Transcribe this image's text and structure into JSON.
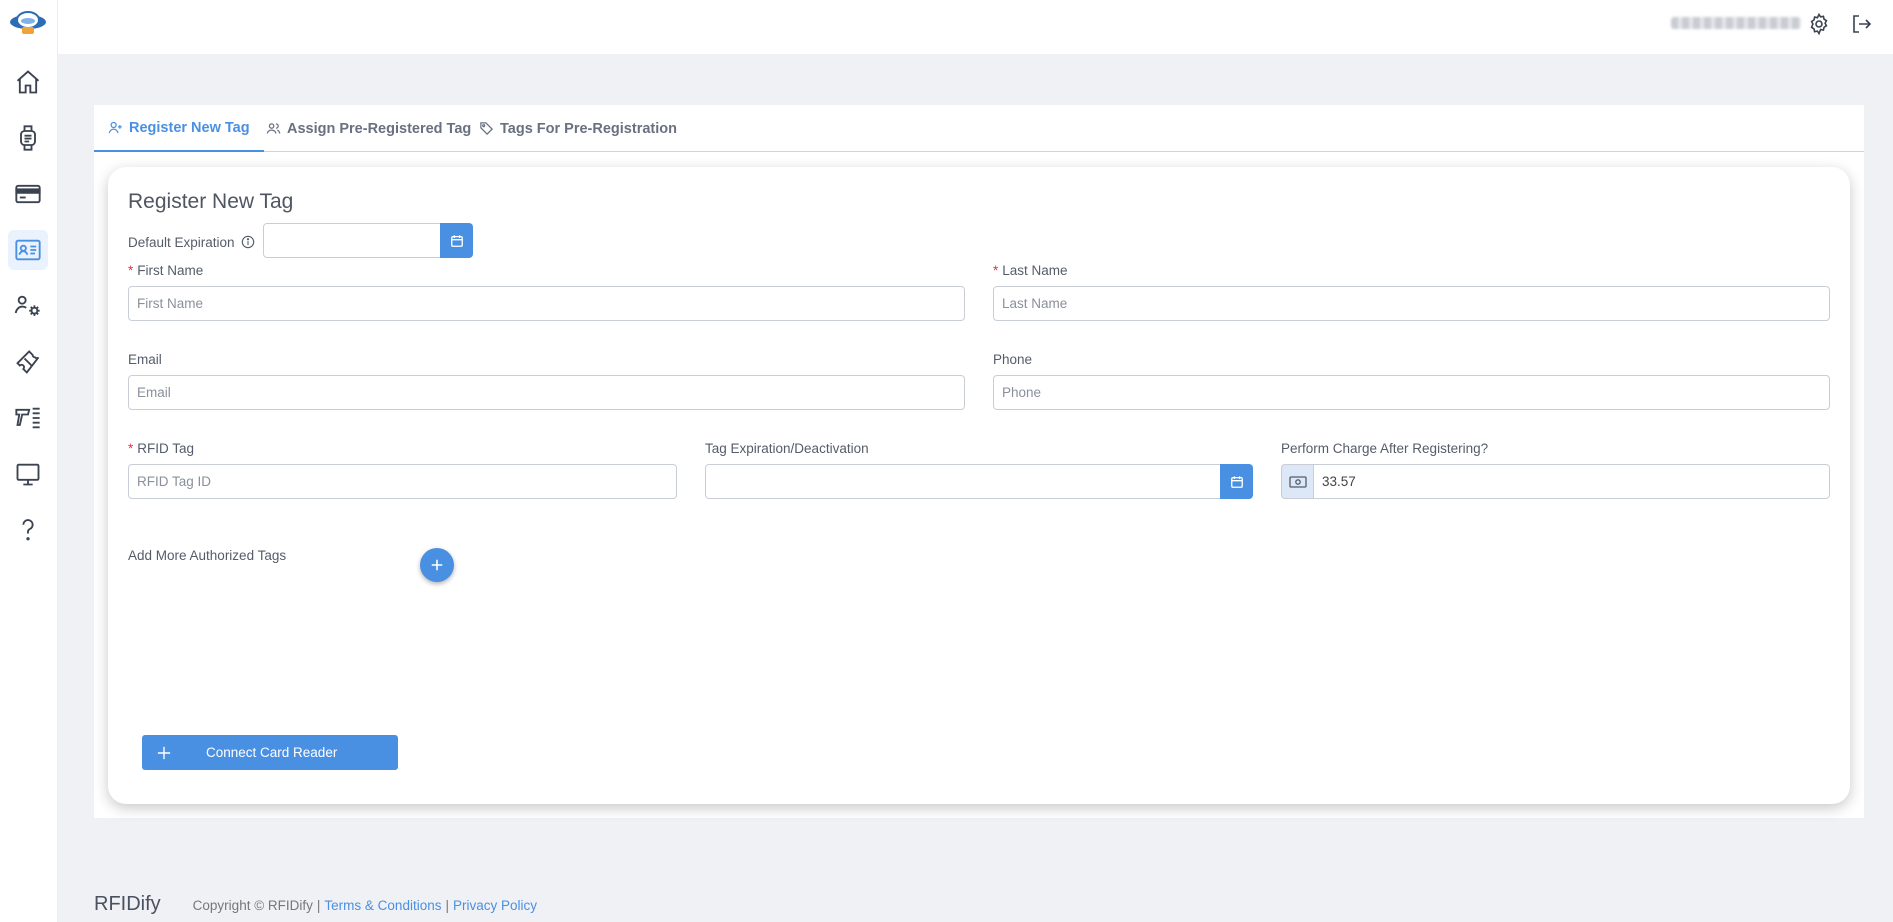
{
  "tabs": [
    {
      "label": "Register New Tag",
      "icon": "user-plus-icon",
      "active": true
    },
    {
      "label": "Assign Pre-Registered Tag",
      "icon": "users-icon",
      "active": false
    },
    {
      "label": "Tags For Pre-Registration",
      "icon": "tag-icon",
      "active": false
    }
  ],
  "form": {
    "title": "Register New Tag",
    "default_expiration_label": "Default Expiration",
    "default_expiration_value": "",
    "first_name_label": "First Name",
    "first_name_placeholder": "First Name",
    "last_name_label": "Last Name",
    "last_name_placeholder": "Last Name",
    "email_label": "Email",
    "email_placeholder": "Email",
    "phone_label": "Phone",
    "phone_placeholder": "Phone",
    "rfid_label": "RFID Tag",
    "rfid_placeholder": "RFID Tag ID",
    "tag_exp_label": "Tag Expiration/Deactivation",
    "tag_exp_value": "",
    "charge_label": "Perform Charge After Registering?",
    "charge_value": "33.57",
    "add_more_label": "Add More Authorized Tags",
    "connect_button": "Connect Card Reader",
    "required_mark": "*"
  },
  "sidebar": {
    "items": [
      {
        "icon": "home-icon"
      },
      {
        "icon": "smartwatch-icon"
      },
      {
        "icon": "credit-card-icon"
      },
      {
        "icon": "id-card-icon",
        "active": true
      },
      {
        "icon": "user-settings-icon"
      },
      {
        "icon": "ticket-icon"
      },
      {
        "icon": "scanner-icon"
      },
      {
        "icon": "monitor-icon"
      },
      {
        "icon": "help-icon"
      }
    ]
  },
  "footer": {
    "brand": "RFIDify",
    "copyright": "Copyright © RFIDify",
    "separator": "|",
    "terms": "Terms & Conditions",
    "privacy": "Privacy Policy"
  },
  "colors": {
    "accent": "#4a90e2",
    "required": "#e0334a",
    "background": "#f0f1f4"
  }
}
